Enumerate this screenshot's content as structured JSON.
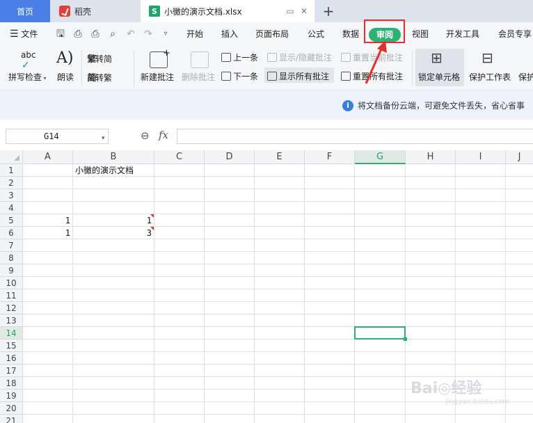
{
  "tabs": {
    "home": "首页",
    "daoke": "稻壳",
    "doc": "小黴的演示文档.xlsx",
    "new_tab": "+",
    "doc_icon_letter": "S"
  },
  "menu": {
    "file": "文件",
    "items": [
      "开始",
      "插入",
      "页面布局",
      "公式",
      "数据",
      "审阅",
      "视图",
      "开发工具",
      "会员专享"
    ]
  },
  "ribbon": {
    "spellcheck": "拼写检查",
    "spellcheck_top": "abc",
    "read_aloud": "朗读",
    "trad_to_simp": "繁转简",
    "simp_to_trad": "简转繁",
    "new_comment": "新建批注",
    "delete_comment": "删除批注",
    "prev": "上一条",
    "next": "下一条",
    "show_hide_comment": "显示/隐藏批注",
    "show_all_comments": "显示所有批注",
    "reset_current_comment": "重置当前批注",
    "reset_all_comments": "重置所有批注",
    "lock_cell": "锁定单元格",
    "protect_sheet": "保护工作表",
    "protect_more": "保护"
  },
  "infobar": {
    "text": "将文档备份云端，可避免文件丢失，省心省事"
  },
  "formula": {
    "namebox": "G14",
    "fx": "fx",
    "value": ""
  },
  "grid": {
    "columns": [
      "A",
      "B",
      "C",
      "D",
      "E",
      "F",
      "G",
      "H",
      "I",
      "J"
    ],
    "rows": [
      "1",
      "2",
      "3",
      "4",
      "5",
      "6",
      "7",
      "8",
      "9",
      "10",
      "11",
      "12",
      "13",
      "14",
      "15",
      "16",
      "17",
      "18",
      "19",
      "20",
      "21"
    ],
    "active_column": "G",
    "active_row": "14",
    "cells": {
      "B1": "小黴的演示文档",
      "A5": "1",
      "B5": "1",
      "A6": "1",
      "B6": "3"
    }
  },
  "colors": {
    "accent": "#2cb274",
    "annotation": "#e0312b",
    "home_tab": "#4a7fe8"
  },
  "watermark": {
    "main": "Bai◎经验",
    "sub": "jingyan.baidu.com"
  }
}
